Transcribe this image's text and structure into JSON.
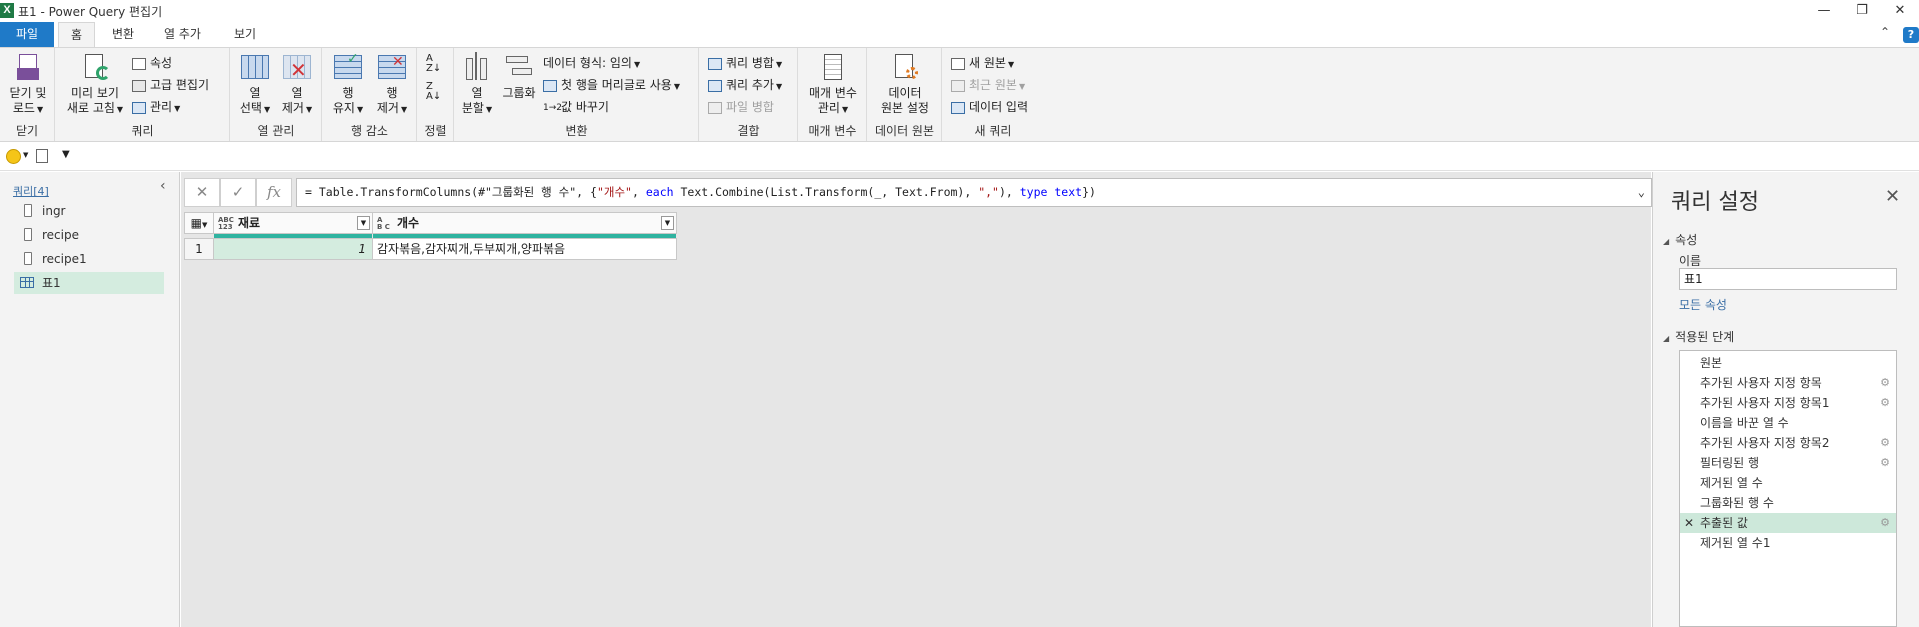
{
  "window": {
    "title": "표1 - Power Query 편집기",
    "logo": "X"
  },
  "tabs": [
    {
      "label": "파일"
    },
    {
      "label": "홈"
    },
    {
      "label": "변환"
    },
    {
      "label": "열 추가"
    },
    {
      "label": "보기"
    }
  ],
  "ribbon": {
    "close": {
      "button": "닫기 및\n로드",
      "label1": "닫기 및",
      "label2": "로드",
      "group": "닫기"
    },
    "query": {
      "refresh1": "미리 보기",
      "refresh2": "새로 고침",
      "properties": "속성",
      "advanced_editor": "고급 편집기",
      "manage": "관리",
      "group": "쿼리"
    },
    "columns": {
      "choose1": "열",
      "choose2": "선택",
      "remove1": "열",
      "remove2": "제거",
      "group": "열 관리"
    },
    "rows": {
      "keep1": "행",
      "keep2": "유지",
      "remove1": "행",
      "remove2": "제거",
      "group": "행 감소"
    },
    "sort": {
      "group": "정렬"
    },
    "transform": {
      "split1": "열",
      "split2": "분할",
      "groupby": "그룹화",
      "datatype": "데이터 형식: 임의",
      "first_row_header": "첫 행을 머리글로 사용",
      "replace_values": "값 바꾸기",
      "group": "변환"
    },
    "combine": {
      "merge_queries": "쿼리 병합",
      "append_queries": "쿼리 추가",
      "combine_files": "파일 병합",
      "group": "결합"
    },
    "parameters": {
      "manage1": "매개 변수",
      "manage2": "관리",
      "group": "매개 변수"
    },
    "datasource": {
      "settings1": "데이터",
      "settings2": "원본 설정",
      "group": "데이터 원본"
    },
    "newquery": {
      "new_source": "새 원본",
      "recent_sources": "최근 원본",
      "enter_data": "데이터 입력",
      "group": "새 쿼리"
    }
  },
  "left_pane": {
    "header": "쿼리[4]",
    "queries": [
      {
        "name": "ingr"
      },
      {
        "name": "recipe"
      },
      {
        "name": "recipe1"
      },
      {
        "name": "표1"
      }
    ]
  },
  "formula_bar": {
    "cancel": "✕",
    "commit": "✓",
    "fx": "fx",
    "p1": "= Table.TransformColumns(#\"그룹화된 행 수\", {",
    "s1": "\"개수\"",
    "p2": ", ",
    "k1": "each",
    "p3": " Text.Combine(List.Transform(_, Text.From), ",
    "s2": "\",\"",
    "p4": "), ",
    "k2": "type text",
    "p5": "})"
  },
  "grid": {
    "columns": [
      {
        "type_top": "ABC",
        "type_bottom": "123",
        "name": "재료"
      },
      {
        "type_top": "A",
        "type_bottom": "B C",
        "name": "개수"
      }
    ],
    "rows": [
      {
        "index": "1",
        "cells": [
          "1",
          "감자볶음,감자찌개,두부찌개,양파볶음"
        ]
      }
    ]
  },
  "right_pane": {
    "title": "쿼리 설정",
    "properties_section": "속성",
    "name_label": "이름",
    "name_value": "표1",
    "all_properties": "모든 속성",
    "steps_section": "적용된 단계",
    "steps": [
      {
        "name": "원본",
        "gear": false
      },
      {
        "name": "추가된 사용자 지정 항목",
        "gear": true
      },
      {
        "name": "추가된 사용자 지정 항목1",
        "gear": true
      },
      {
        "name": "이름을 바꾼 열 수",
        "gear": false
      },
      {
        "name": "추가된 사용자 지정 항목2",
        "gear": true
      },
      {
        "name": "필터링된 행",
        "gear": true
      },
      {
        "name": "제거된 열 수",
        "gear": false
      },
      {
        "name": "그룹화된 행 수",
        "gear": false
      },
      {
        "name": "추출된 값",
        "gear": true,
        "selected": true
      },
      {
        "name": "제거된 열 수1",
        "gear": false
      }
    ]
  },
  "colors": {
    "accent": "#1f7ac8",
    "excel_green": "#1f7a45",
    "selected_row": "#cde8da",
    "quality_bar": "#2fb3a0"
  }
}
